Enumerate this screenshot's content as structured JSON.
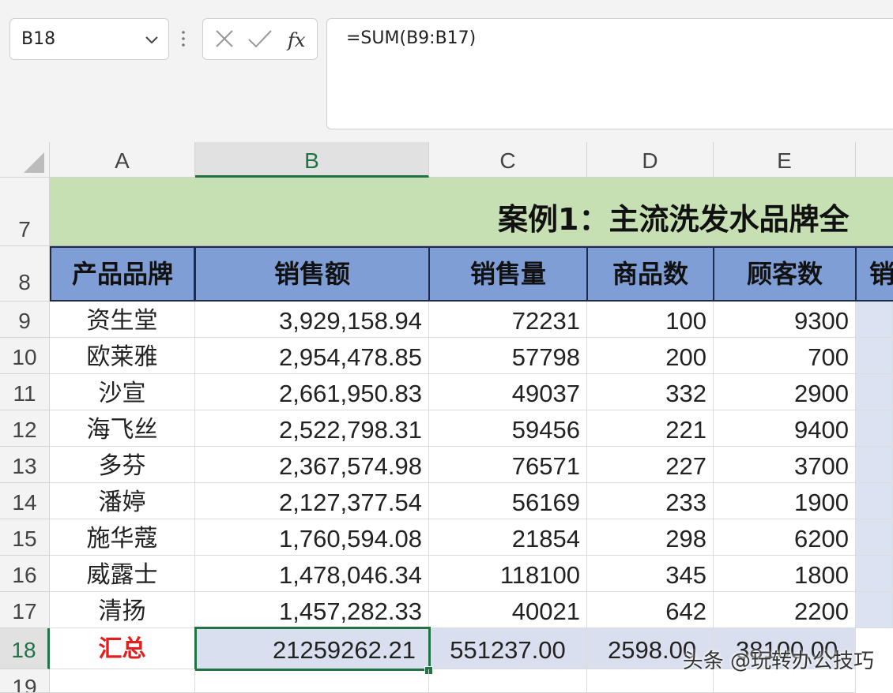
{
  "formula_bar": {
    "name_box": "B18",
    "formula": "=SUM(B9:B17)"
  },
  "columns": [
    "A",
    "B",
    "C",
    "D",
    "E"
  ],
  "rows": [
    "7",
    "8",
    "9",
    "10",
    "11",
    "12",
    "13",
    "14",
    "15",
    "16",
    "17",
    "18",
    "19"
  ],
  "sheet": {
    "title": "案例1：主流洗发水品牌全",
    "headers": [
      "产品品牌",
      "销售额",
      "销售量",
      "商品数",
      "顾客数",
      "销"
    ],
    "data": [
      [
        "资生堂",
        "3,929,158.94",
        "72231",
        "100",
        "9300"
      ],
      [
        "欧莱雅",
        "2,954,478.85",
        "57798",
        "200",
        "700"
      ],
      [
        "沙宣",
        "2,661,950.83",
        "49037",
        "332",
        "2900"
      ],
      [
        "海飞丝",
        "2,522,798.31",
        "59456",
        "221",
        "9400"
      ],
      [
        "多芬",
        "2,367,574.98",
        "76571",
        "227",
        "3700"
      ],
      [
        "潘婷",
        "2,127,377.54",
        "56169",
        "233",
        "1900"
      ],
      [
        "施华蔻",
        "1,760,594.08",
        "21854",
        "298",
        "6200"
      ],
      [
        "威露士",
        "1,478,046.34",
        "118100",
        "345",
        "1800"
      ],
      [
        "清扬",
        "1,457,282.33",
        "40021",
        "642",
        "2200"
      ]
    ],
    "total": [
      "汇总",
      "21259262.21",
      "551237.00",
      "2598.00",
      "38100.00"
    ]
  },
  "watermark": "头条 @玩转办公技巧",
  "colors": {
    "title_fill": "#c6e0b4",
    "header_fill": "#7f9ed6",
    "selection_accent": "#217346",
    "total_text": "#e02020"
  }
}
